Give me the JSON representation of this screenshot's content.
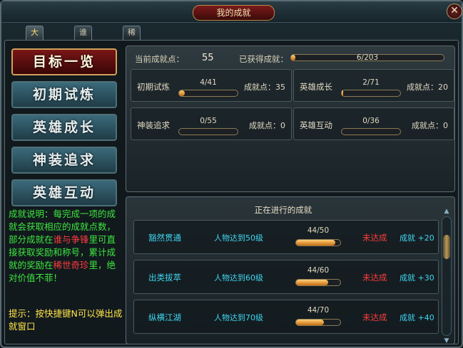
{
  "window": {
    "title": "我的成就",
    "close_icon": "close-icon"
  },
  "tabs": [
    {
      "label": "大汉江山",
      "active": true
    },
    {
      "label": "谁与争锋",
      "active": false
    },
    {
      "label": "稀世奇珍",
      "active": false
    }
  ],
  "sidebar": {
    "items": [
      {
        "label": "目标一览",
        "active": true
      },
      {
        "label": "初期试炼",
        "active": false
      },
      {
        "label": "英雄成长",
        "active": false
      },
      {
        "label": "神装追求",
        "active": false
      },
      {
        "label": "英雄互动",
        "active": false
      }
    ]
  },
  "description": {
    "p1": "成就说明：每完成一项的成就会获取相应的成就点数，部分成就在",
    "h1": "谁与争锋",
    "p2": "里可直接获取奖励和称号，累计成就的奖励在",
    "h2": "稀世奇珍",
    "p3": "里，绝对价值不菲！"
  },
  "tip": "提示：按快捷键N可以弹出成就窗口",
  "summary": {
    "points_label": "当前成就点：",
    "points_value": "55",
    "obtained_label": "已获得成就：",
    "obtained_text": "6/203",
    "obtained_progress": 0.03
  },
  "categories": [
    {
      "name": "初期试炼",
      "progress_text": "4/41",
      "progress": 0.1,
      "points_label": "成就点：35"
    },
    {
      "name": "英雄成长",
      "progress_text": "2/71",
      "progress": 0.03,
      "points_label": "成就点：20"
    },
    {
      "name": "神装追求",
      "progress_text": "0/55",
      "progress": 0.0,
      "points_label": "成就点：0"
    },
    {
      "name": "英雄互动",
      "progress_text": "0/36",
      "progress": 0.0,
      "points_label": "成就点：0"
    }
  ],
  "in_progress": {
    "title": "正在进行的成就",
    "rows": [
      {
        "name": "豁然贯通",
        "requirement": "人物达到50级",
        "progress_text": "44/50",
        "progress": 0.88,
        "status": "未达成",
        "reward": "成就 +20"
      },
      {
        "name": "出类拔萃",
        "requirement": "人物达到60级",
        "progress_text": "44/60",
        "progress": 0.73,
        "status": "未达成",
        "reward": "成就 +30"
      },
      {
        "name": "纵横江湖",
        "requirement": "人物达到70级",
        "progress_text": "44/70",
        "progress": 0.63,
        "status": "未达成",
        "reward": "成就 +40"
      }
    ]
  },
  "colors": {
    "accent": "#ffd86a",
    "progress_fill": "#e89a30",
    "status_red": "#ff3c3c",
    "info_cyan": "#3fd6f0",
    "desc_green": "#3ee63e"
  }
}
